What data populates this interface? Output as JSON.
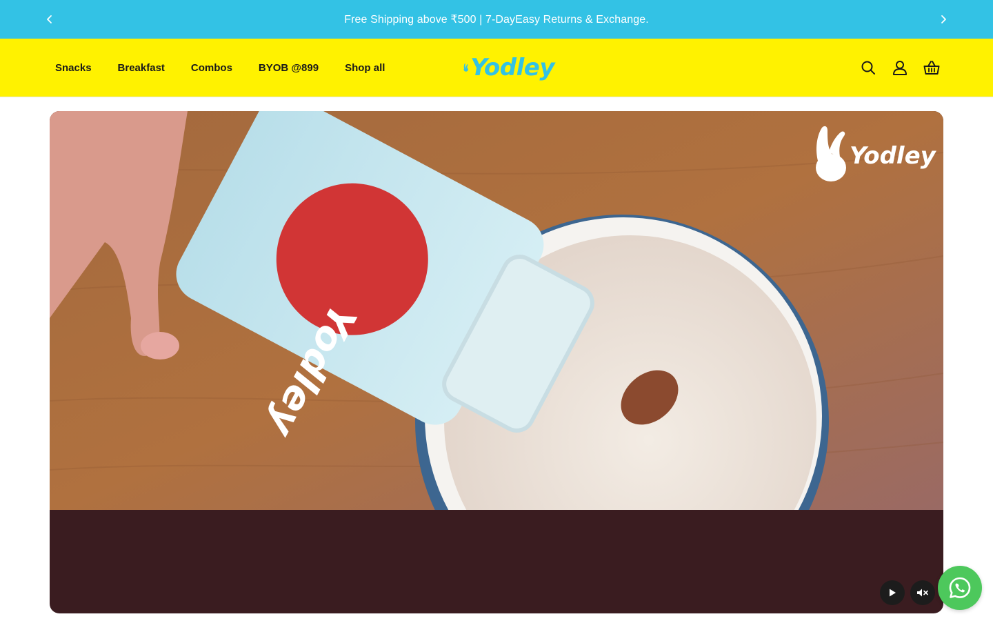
{
  "announcement": {
    "text": "Free Shipping above ₹500 | 7-DayEasy Returns & Exchange.",
    "prev_icon": "chevron-left-icon",
    "next_icon": "chevron-right-icon"
  },
  "header": {
    "nav": [
      {
        "label": "Snacks"
      },
      {
        "label": "Breakfast"
      },
      {
        "label": "Combos"
      },
      {
        "label": "BYOB @899"
      },
      {
        "label": "Shop all"
      }
    ],
    "logo_text": "Yodley",
    "icons": [
      "search-icon",
      "account-icon",
      "basket-icon"
    ]
  },
  "hero": {
    "watermark_text": "Yodley",
    "bottle_label_text": "Yodley",
    "controls": [
      "play-icon",
      "mute-icon"
    ]
  },
  "colors": {
    "announcement_bg": "#33c2e5",
    "header_bg": "#fff200",
    "brand_blue": "#33c2e5",
    "hero_bottom": "#3a1c20",
    "whatsapp": "#4dc85c"
  }
}
